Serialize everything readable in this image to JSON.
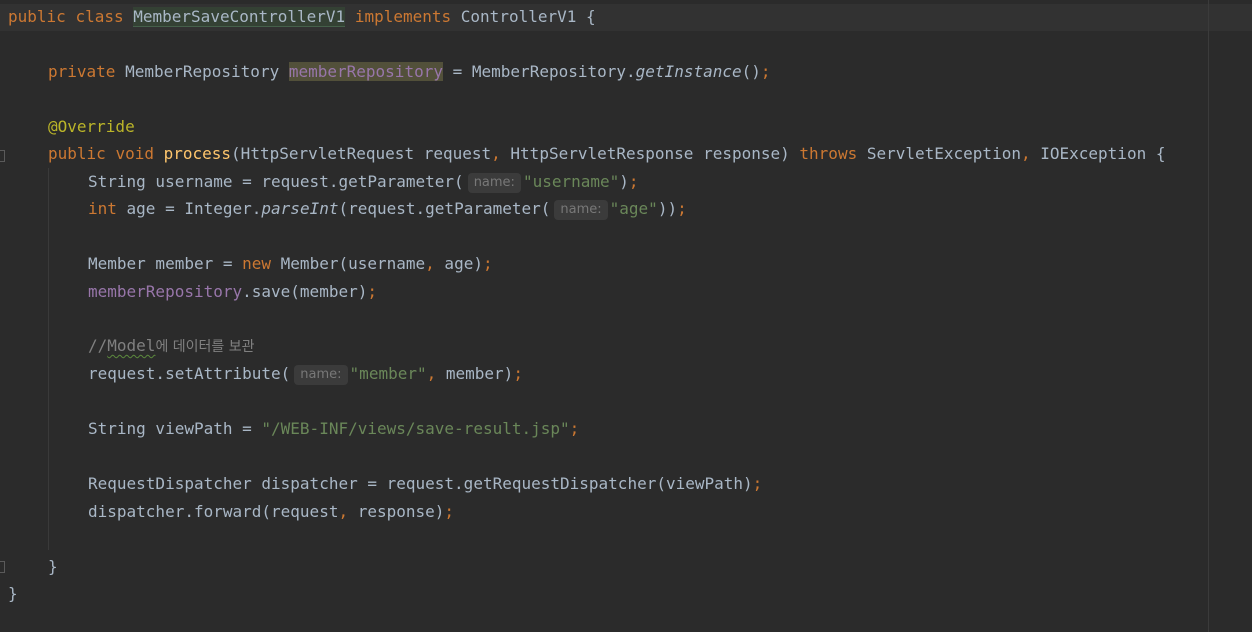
{
  "editor": {
    "class_decl": {
      "kw_public": "public",
      "kw_class": "class",
      "class_name": "MemberSaveControllerV1",
      "kw_implements": "implements",
      "interface_name": "ControllerV1",
      "open_brace": "{"
    },
    "field_decl": {
      "kw_private": "private",
      "type": "MemberRepository",
      "name": "memberRepository",
      "assign": "=",
      "call_target": "MemberRepository.",
      "call_method": "getInstance",
      "call_end": "()",
      "semicolon": ";"
    },
    "annotation": "@Override",
    "method_decl": {
      "kw_public": "public",
      "kw_void": "void",
      "name": "process",
      "params_1": "(HttpServletRequest request",
      "comma_1": ",",
      "params_2": " HttpServletResponse response) ",
      "kw_throws": "throws",
      "exc_1": " ServletException",
      "comma_2": ",",
      "exc_2": " IOException {"
    },
    "line_username": {
      "prefix": "String username = request.getParameter(",
      "hint": "name:",
      "arg": "\"username\"",
      "suffix": ")",
      "semicolon": ";"
    },
    "line_age": {
      "kw_int": "int",
      "middle": " age = Integer.",
      "method": "parseInt",
      "call": "(request.getParameter(",
      "hint": "name:",
      "arg": "\"age\"",
      "suffix": "))",
      "semicolon": ";"
    },
    "line_member": {
      "prefix": "Member member = ",
      "kw_new": "new",
      "call": " Member(username",
      "comma": ",",
      "rest": " age)",
      "semicolon": ";"
    },
    "line_save": {
      "field": "memberRepository",
      "call": ".save(member)",
      "semicolon": ";"
    },
    "comment": {
      "slashes": "//",
      "word": "Model",
      "korean": "에 데이터를 보관"
    },
    "line_set_attr": {
      "prefix": "request.setAttribute(",
      "hint": "name:",
      "arg": "\"member\"",
      "comma": ",",
      "rest": " member)",
      "semicolon": ";"
    },
    "line_view_path": {
      "prefix": "String viewPath = ",
      "value": "\"/WEB-INF/views/save-result.jsp\"",
      "semicolon": ";"
    },
    "line_dispatcher": {
      "prefix": "RequestDispatcher dispatcher = request.getRequestDispatcher(viewPath)",
      "semicolon": ";"
    },
    "line_forward": {
      "prefix": "dispatcher.forward(request",
      "comma": ",",
      "rest": " response)",
      "semicolon": ";"
    },
    "method_close": "}",
    "class_close": "}"
  }
}
